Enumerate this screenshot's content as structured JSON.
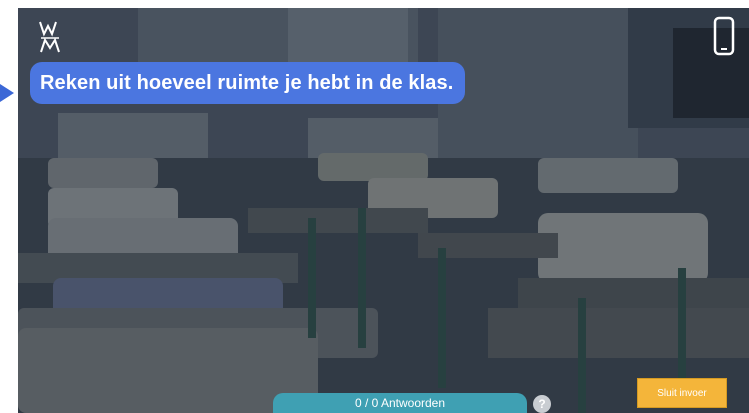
{
  "question": {
    "text": "Reken uit hoeveel ruimte je hebt in de klas."
  },
  "footer": {
    "answers_count": "0 / 0 Antwoorden",
    "help_symbol": "?",
    "close_button_label": "Sluit invoer"
  },
  "icons": {
    "logo": "wm-logo-icon",
    "device": "phone-icon",
    "pointer": "arrow-pointer-icon"
  },
  "colors": {
    "question_bg": "#4b76e0",
    "answers_bar": "#3fa0b3",
    "close_button": "#f4b53a"
  }
}
